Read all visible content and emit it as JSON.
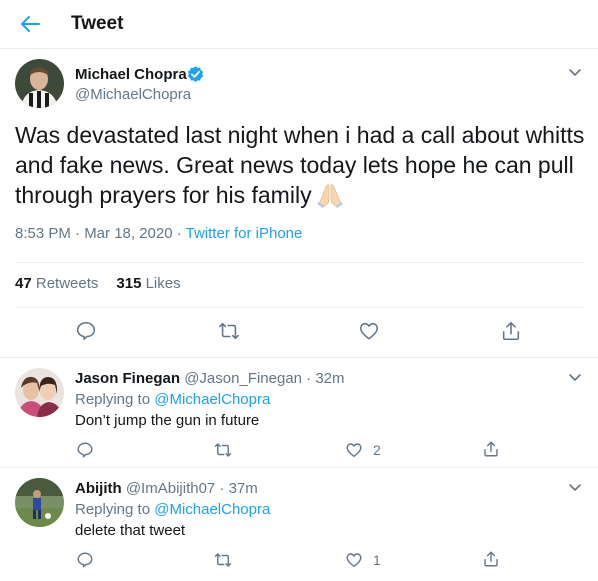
{
  "header": {
    "title": "Tweet"
  },
  "tweet": {
    "author_name": "Michael Chopra",
    "author_handle": "@MichaelChopra",
    "text": "Was devastated last night when i had a call about whitts and fake news. Great news today lets hope he can pull through prayers for his family",
    "emoji": "folded-hands",
    "timestamp": "8:53 PM · Mar 18, 2020 · ",
    "source": "Twitter for iPhone",
    "retweets_count": "47",
    "retweets_label": "Retweets",
    "likes_count": "315",
    "likes_label": "Likes"
  },
  "replies": [
    {
      "name": "Jason Finegan",
      "handle_time": "@Jason_Finegan · 32m",
      "replying_prefix": "Replying to ",
      "replying_to": "@MichaelChopra",
      "text": "Don’t jump the gun in future",
      "like_count": "2"
    },
    {
      "name": "Abijith",
      "handle_time": "@ImAbijith07 · 37m",
      "replying_prefix": "Replying to ",
      "replying_to": "@MichaelChopra",
      "text": "delete that tweet",
      "like_count": "1"
    }
  ],
  "colors": {
    "accent": "#1da1f2",
    "text": "#14171a",
    "secondary": "#657786",
    "border": "#e6ecf0"
  },
  "icons": [
    "back-arrow-icon",
    "verified-badge-icon",
    "chevron-down-icon",
    "reply-icon",
    "retweet-icon",
    "like-icon",
    "share-icon",
    "folded-hands-emoji"
  ]
}
